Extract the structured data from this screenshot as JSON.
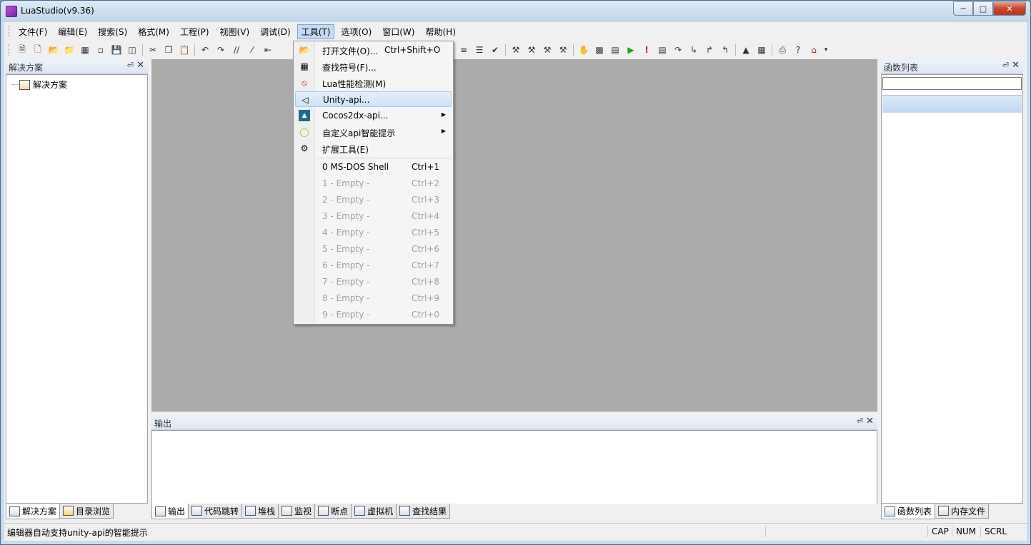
{
  "window": {
    "title": "LuaStudio(v9.36)"
  },
  "menubar": {
    "items": [
      "文件(F)",
      "编辑(E)",
      "搜索(S)",
      "格式(M)",
      "工程(P)",
      "视图(V)",
      "调试(D)",
      "工具(T)",
      "选项(O)",
      "窗口(W)",
      "帮助(H)"
    ],
    "active_index": 7
  },
  "solution_pane": {
    "title": "解决方案",
    "tree_root": "解决方案",
    "tabs": [
      "解决方案",
      "目录浏览"
    ]
  },
  "function_pane": {
    "title": "函数列表",
    "search_value": "",
    "tabs": [
      "函数列表",
      "内存文件"
    ]
  },
  "output_pane": {
    "title": "输出",
    "tabs": [
      "输出",
      "代码跳转",
      "堆栈",
      "监视",
      "断点",
      "虚拟机",
      "查找结果"
    ]
  },
  "tools_menu": {
    "items": [
      {
        "label": "打开文件(O)...",
        "shortcut": "Ctrl+Shift+O",
        "icon": "open-file-icon"
      },
      {
        "label": "查找符号(F)...",
        "shortcut": "",
        "icon": "find-symbol-icon"
      },
      {
        "label": "Lua性能检测(M)",
        "shortcut": "",
        "icon": "profiler-icon"
      },
      {
        "label": "Unity-api...",
        "shortcut": "",
        "icon": "unity-icon",
        "highlighted": true
      },
      {
        "label": "Cocos2dx-api...",
        "shortcut": "",
        "icon": "cocos-icon",
        "submenu": true
      },
      {
        "label": "自定义api智能提示",
        "shortcut": "",
        "icon": "lightbulb-icon",
        "submenu": true
      },
      {
        "label": "扩展工具(E)",
        "shortcut": "",
        "icon": "gears-icon"
      }
    ],
    "shells": [
      {
        "label": "0 MS-DOS Shell",
        "shortcut": "Ctrl+1",
        "enabled": true
      },
      {
        "label": "1 - Empty -",
        "shortcut": "Ctrl+2",
        "enabled": false
      },
      {
        "label": "2 - Empty -",
        "shortcut": "Ctrl+3",
        "enabled": false
      },
      {
        "label": "3 - Empty -",
        "shortcut": "Ctrl+4",
        "enabled": false
      },
      {
        "label": "4 - Empty -",
        "shortcut": "Ctrl+5",
        "enabled": false
      },
      {
        "label": "5 - Empty -",
        "shortcut": "Ctrl+6",
        "enabled": false
      },
      {
        "label": "6 - Empty -",
        "shortcut": "Ctrl+7",
        "enabled": false
      },
      {
        "label": "7 - Empty -",
        "shortcut": "Ctrl+8",
        "enabled": false
      },
      {
        "label": "8 - Empty -",
        "shortcut": "Ctrl+9",
        "enabled": false
      },
      {
        "label": "9 - Empty -",
        "shortcut": "Ctrl+0",
        "enabled": false
      }
    ]
  },
  "statusbar": {
    "text": "编辑器自动支持unity-api的智能提示",
    "cap": "CAP",
    "num": "NUM",
    "scrl": "SCRL"
  }
}
